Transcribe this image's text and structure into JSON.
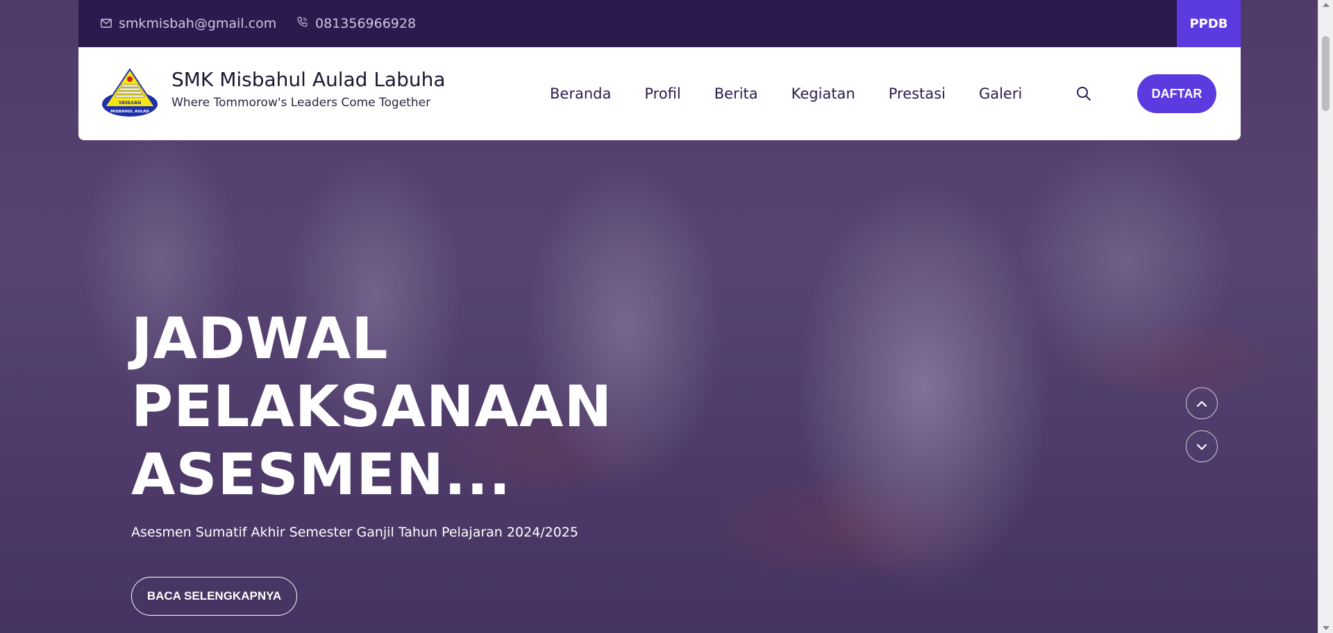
{
  "topbar": {
    "email": "smkmisbah@gmail.com",
    "email_icon": "mail-icon",
    "phone": "081356966928",
    "phone_icon": "phone-icon",
    "ppdb_label": "PPDB"
  },
  "header": {
    "school_name": "SMK Misbahul Aulad Labuha",
    "tagline": "Where Tommorow's Leaders Come Together",
    "logo_text_top": "YAYASAN",
    "logo_text_bottom": "MISBAHUL AULAD",
    "nav": [
      {
        "label": "Beranda"
      },
      {
        "label": "Profil"
      },
      {
        "label": "Berita"
      },
      {
        "label": "Kegiatan"
      },
      {
        "label": "Prestasi"
      },
      {
        "label": "Galeri"
      }
    ],
    "search_icon": "search-icon",
    "cta_label": "DAFTAR"
  },
  "hero": {
    "title_lines": [
      "JADWAL",
      "PELAKSANAAN",
      "ASESMEN..."
    ],
    "subtitle": "Asesmen Sumatif Akhir Semester Ganjil Tahun Pelajaran 2024/2025",
    "button_label": "BACA SELENGKAPNYA",
    "prev_icon": "chevron-up-icon",
    "next_icon": "chevron-down-icon"
  },
  "colors": {
    "accent": "#5b3ae0",
    "topbar_bg": "#2b1a4d",
    "nav_text": "#2b1a4d"
  }
}
